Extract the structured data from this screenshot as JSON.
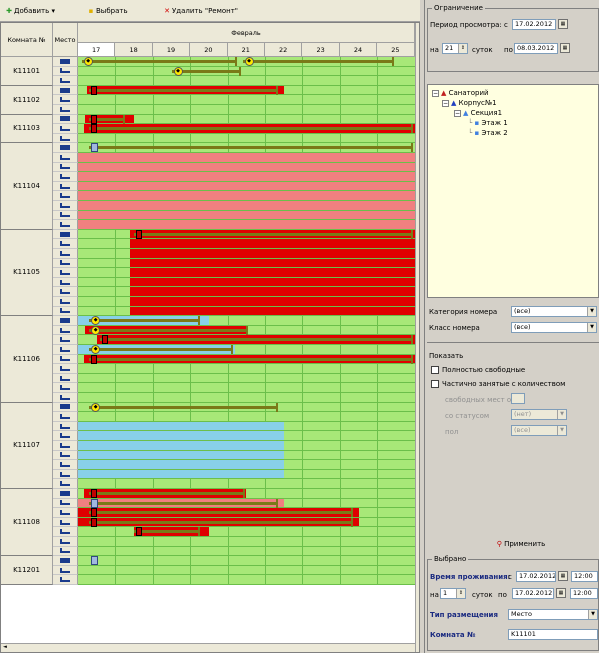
{
  "toolbar": {
    "add_label": "Добавить",
    "select_label": "Выбрать",
    "delete_label": "Удалить \"Ремонт\""
  },
  "grid": {
    "room_header": "Комната №",
    "bed_header": "Место",
    "month": "Февраль",
    "days": [
      "17",
      "18",
      "19",
      "20",
      "21",
      "22",
      "23",
      "24",
      "25"
    ],
    "selected_day": "17",
    "rooms": [
      {
        "number": "K11101",
        "beds": 3
      },
      {
        "number": "K11102",
        "beds": 3
      },
      {
        "number": "K11103",
        "beds": 3
      },
      {
        "number": "K11104",
        "beds": 9
      },
      {
        "number": "K11105",
        "beds": 9
      },
      {
        "number": "K11106",
        "beds": 9
      },
      {
        "number": "K11107",
        "beds": 9
      },
      {
        "number": "K11108",
        "beds": 7
      },
      {
        "number": "K11201",
        "beds": 3
      }
    ]
  },
  "legend_colors": {
    "free": "#a8e878",
    "occupied": "#e00000",
    "repair": "#f08080",
    "reserved": "#88d0e8",
    "stay_bar": "#7a7a18"
  },
  "restriction": {
    "title": "Ограничение",
    "period_label": "Период просмотра:",
    "from_prefix": "с",
    "from_date": "17.02.2012",
    "on_prefix": "на",
    "days_value": "21",
    "days_label": "суток",
    "to_prefix": "по",
    "to_date": "08.03.2012"
  },
  "tree": {
    "root": "Санаторий",
    "building": "Корпус№1",
    "section": "Секция1",
    "floors": [
      "Этаж 1",
      "Этаж 2"
    ]
  },
  "filters": {
    "category_label": "Категория номера",
    "category_value": "(все)",
    "class_label": "Класс номера",
    "class_value": "(все)"
  },
  "show": {
    "title": "Показать",
    "fully_free": "Полностью свободные",
    "partial": "Частично занятые с количеством",
    "free_places_label": "свободных мест от",
    "status_label": "со статусом",
    "status_value": "(нет)",
    "gender_label": "пол",
    "gender_value": "(все)",
    "apply_label": "Применить"
  },
  "selected": {
    "title": "Выбрано",
    "stay_label": "Время проживания:",
    "from_prefix": "с",
    "from_date": "17.02.2012",
    "from_time": "12:00",
    "on_prefix": "на",
    "days_value": "1",
    "days_label": "суток",
    "to_prefix": "по",
    "to_date": "17.02.2012",
    "to_time": "12:00",
    "placement_label": "Тип размещения",
    "placement_value": "Место",
    "room_label": "Комната №",
    "room_value": "K11101"
  }
}
